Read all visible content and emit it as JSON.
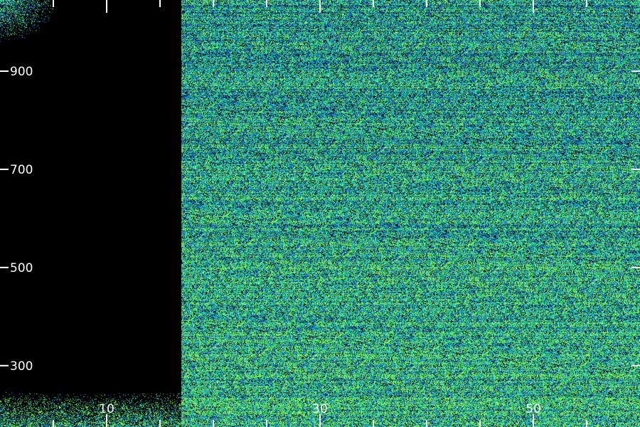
{
  "chart_data": {
    "type": "heatmap",
    "title": "",
    "xlabel": "",
    "ylabel": "",
    "colormap": [
      "#000000",
      "#0a1f8a",
      "#1577d8",
      "#17c4b5",
      "#2fe36a",
      "#b4ff3a"
    ],
    "background": "#000000",
    "axis_color": "#ffffff",
    "x_ticks": [
      {
        "value": 10,
        "label": "10"
      },
      {
        "value": 30,
        "label": "30"
      },
      {
        "value": 50,
        "label": "50"
      }
    ],
    "x_minor_ticks": [
      5,
      15,
      20,
      25,
      35,
      40,
      45,
      55
    ],
    "y_ticks": [
      {
        "value": 900,
        "label": "900"
      },
      {
        "value": 700,
        "label": "700"
      },
      {
        "value": 500,
        "label": "500"
      },
      {
        "value": 300,
        "label": "300"
      }
    ],
    "xlim": [
      0,
      60
    ],
    "ylim": [
      175,
      1045
    ],
    "blank_region": {
      "x_range": [
        0,
        17
      ]
    },
    "grid": false,
    "legend": "none"
  }
}
